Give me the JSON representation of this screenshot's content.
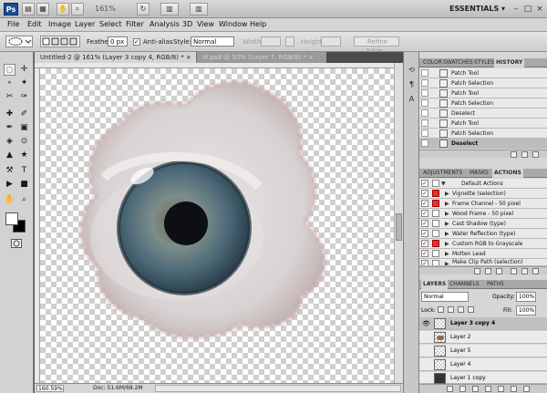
{
  "appbar": {
    "logo": "Ps",
    "zoom": "161%",
    "workspace": "ESSENTIALS ▾",
    "buttons": [
      "▤",
      "▦",
      "✋",
      "⌕",
      "↻",
      "▥"
    ],
    "window_controls": [
      "–",
      "□",
      "×"
    ]
  },
  "menu": [
    "File",
    "Edit",
    "Image",
    "Layer",
    "Select",
    "Filter",
    "Analysis",
    "3D",
    "View",
    "Window",
    "Help"
  ],
  "options": {
    "feather_label": "Feather:",
    "feather_value": "0 px",
    "antialias_label": "Anti-alias",
    "style_label": "Style:",
    "style_value": "Normal",
    "width_label": "Width:",
    "height_label": "Height:",
    "refine_edge": "Refine Edge..."
  },
  "tools": [
    "◌",
    "✛",
    "∘",
    "✦",
    "✂",
    "✑",
    "✚",
    "✐",
    "✒",
    "▣",
    "◈",
    "⊙",
    "▲",
    "★",
    "⚒",
    "T",
    "▶",
    "■",
    "✋",
    "⌕"
  ],
  "tabs": {
    "active": "Untitled-2 @ 161% (Layer 3 copy 4, RGB/8) * ×",
    "inactive": "III.psd @ 50% (Layer 7, RGB/8) * ×"
  },
  "status": {
    "zoom": "160.59%",
    "doc": "Doc: 51.6M/68.2M"
  },
  "history": {
    "tabs": [
      "COLOR",
      "SWATCHES",
      "STYLES",
      "HISTORY"
    ],
    "items": [
      "Patch Tool",
      "Patch Selection",
      "Patch Tool",
      "Patch Selection",
      "Deselect",
      "Patch Tool",
      "Patch Selection",
      "Deselect"
    ]
  },
  "actions": {
    "tabs": [
      "ADJUSTMENTS",
      "MASKS",
      "ACTIONS"
    ],
    "set_name": "Default Actions",
    "items": [
      "Vignette (selection)",
      "Frame Channel - 50 pixel",
      "Wood Frame - 50 pixel",
      "Cast Shadow (type)",
      "Water Reflection (type)",
      "Custom RGB to Grayscale",
      "Molten Lead",
      "Make Clip Path (selection)"
    ]
  },
  "layers": {
    "tabs": [
      "LAYERS",
      "CHANNELS",
      "PATHS"
    ],
    "blend_mode": "Normal",
    "opacity_label": "Opacity:",
    "opacity_value": "100%",
    "lock_label": "Lock:",
    "fill_label": "Fill:",
    "fill_value": "100%",
    "items": [
      "Layer 3 copy 4",
      "Layer 2",
      "Layer 5",
      "Layer 4",
      "Layer 1 copy"
    ]
  },
  "colors": {
    "ps_blue": "#1c4d96",
    "action_red": "#e03030"
  }
}
